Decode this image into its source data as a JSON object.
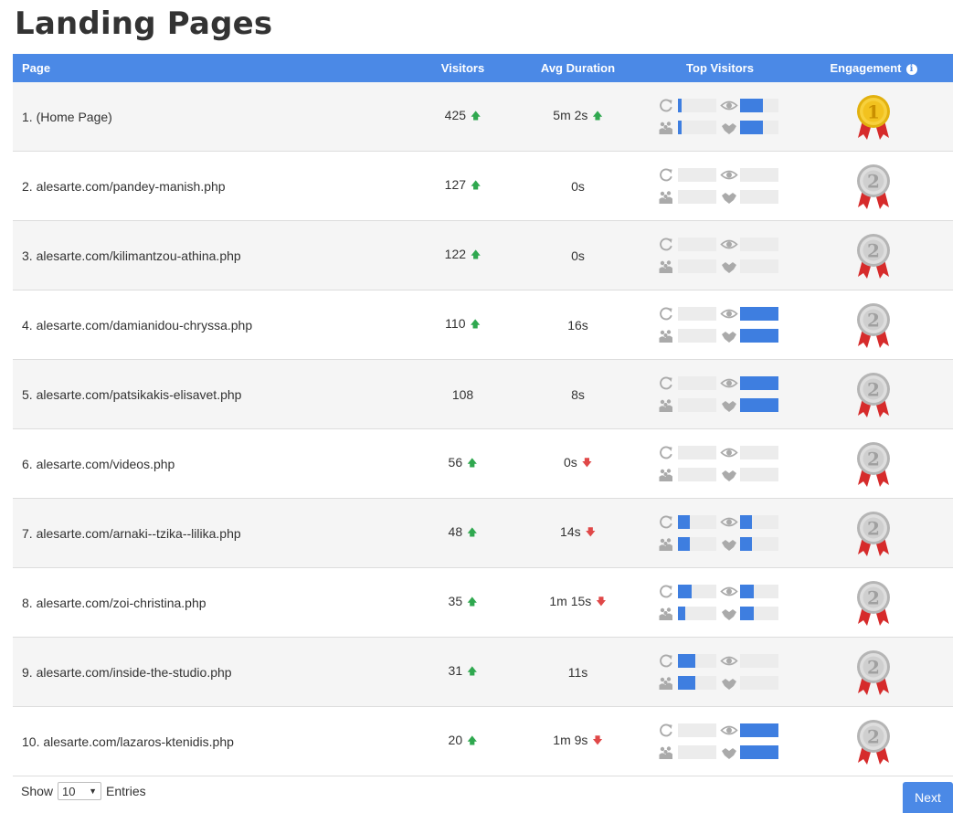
{
  "title": "Landing Pages",
  "columns": {
    "page": "Page",
    "visitors": "Visitors",
    "avg_duration": "Avg Duration",
    "top_visitors": "Top Visitors",
    "engagement": "Engagement"
  },
  "colors": {
    "header": "#4b89e6",
    "bar_fill": "#3e7ee0",
    "bar_track": "#ececec",
    "trend_up": "#2fa84f",
    "trend_down": "#e04848"
  },
  "rows": [
    {
      "page": "1. (Home Page)",
      "visitors": "425",
      "visitors_trend": "up",
      "duration": "5m 2s",
      "duration_trend": "up",
      "bars": {
        "returning": 0.1,
        "views": 0.6,
        "new": 0.1,
        "loyal": 0.6
      },
      "medal": "1"
    },
    {
      "page": "2. alesarte.com/pandey-manish.php",
      "visitors": "127",
      "visitors_trend": "up",
      "duration": "0s",
      "duration_trend": "",
      "bars": {
        "returning": 0,
        "views": 0,
        "new": 0,
        "loyal": 0
      },
      "medal": "2"
    },
    {
      "page": "3. alesarte.com/kilimantzou-athina.php",
      "visitors": "122",
      "visitors_trend": "up",
      "duration": "0s",
      "duration_trend": "",
      "bars": {
        "returning": 0,
        "views": 0,
        "new": 0,
        "loyal": 0
      },
      "medal": "2"
    },
    {
      "page": "4. alesarte.com/damianidou-chryssa.php",
      "visitors": "110",
      "visitors_trend": "up",
      "duration": "16s",
      "duration_trend": "",
      "bars": {
        "returning": 0,
        "views": 1,
        "new": 0,
        "loyal": 1
      },
      "medal": "2"
    },
    {
      "page": "5. alesarte.com/patsikakis-elisavet.php",
      "visitors": "108",
      "visitors_trend": "",
      "duration": "8s",
      "duration_trend": "",
      "bars": {
        "returning": 0,
        "views": 1,
        "new": 0,
        "loyal": 1
      },
      "medal": "2"
    },
    {
      "page": "6. alesarte.com/videos.php",
      "visitors": "56",
      "visitors_trend": "up",
      "duration": "0s",
      "duration_trend": "down",
      "bars": {
        "returning": 0,
        "views": 0,
        "new": 0,
        "loyal": 0
      },
      "medal": "2"
    },
    {
      "page": "7. alesarte.com/arnaki--tzika--lilika.php",
      "visitors": "48",
      "visitors_trend": "up",
      "duration": "14s",
      "duration_trend": "down",
      "bars": {
        "returning": 0.3,
        "views": 0.3,
        "new": 0.3,
        "loyal": 0.3
      },
      "medal": "2"
    },
    {
      "page": "8. alesarte.com/zoi-christina.php",
      "visitors": "35",
      "visitors_trend": "up",
      "duration": "1m 15s",
      "duration_trend": "down",
      "bars": {
        "returning": 0.35,
        "views": 0.35,
        "new": 0.2,
        "loyal": 0.35
      },
      "medal": "2"
    },
    {
      "page": "9. alesarte.com/inside-the-studio.php",
      "visitors": "31",
      "visitors_trend": "up",
      "duration": "11s",
      "duration_trend": "",
      "bars": {
        "returning": 0.45,
        "views": 0,
        "new": 0.45,
        "loyal": 0
      },
      "medal": "2"
    },
    {
      "page": "10. alesarte.com/lazaros-ktenidis.php",
      "visitors": "20",
      "visitors_trend": "up",
      "duration": "1m 9s",
      "duration_trend": "down",
      "bars": {
        "returning": 0,
        "views": 1,
        "new": 0,
        "loyal": 1
      },
      "medal": "2"
    }
  ],
  "footer": {
    "show_label": "Show",
    "entries_value": "10",
    "entries_label": "Entries",
    "next_label": "Next"
  }
}
